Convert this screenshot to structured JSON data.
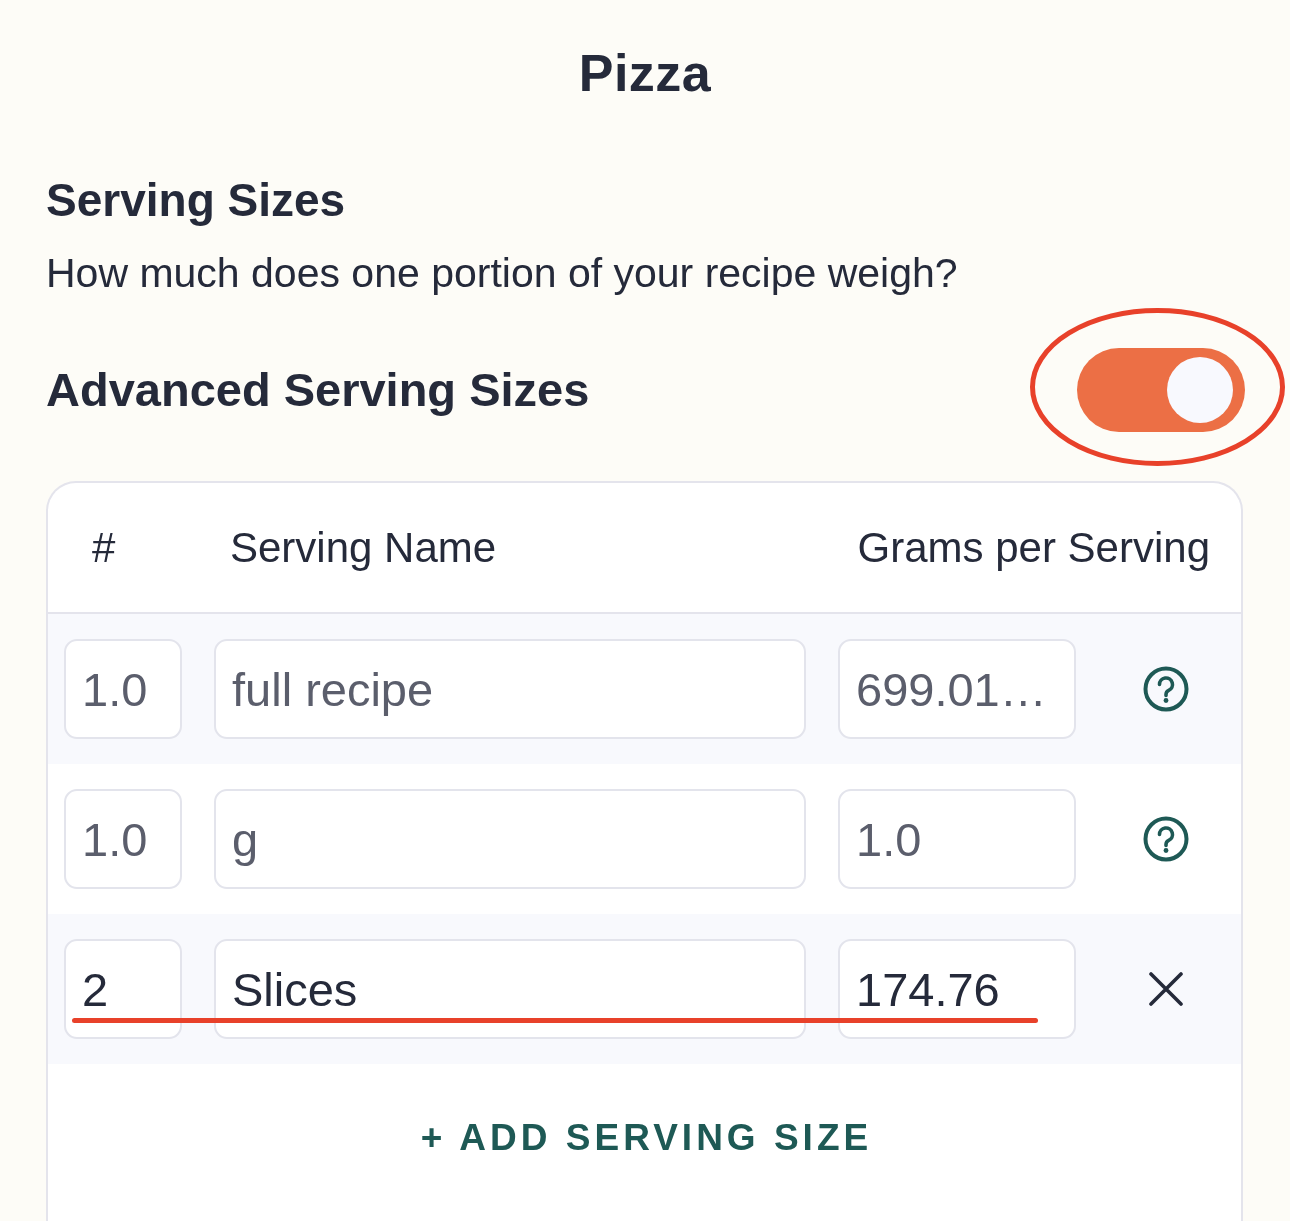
{
  "title": "Pizza",
  "serving_sizes": {
    "heading": "Serving Sizes",
    "description": "How much does one portion of your recipe weigh?"
  },
  "advanced": {
    "label": "Advanced Serving Sizes",
    "on": true,
    "circled": true
  },
  "table": {
    "columns": [
      "#",
      "Serving Name",
      "Grams per Serving"
    ],
    "rows": [
      {
        "kind": "fixed",
        "count": "1.0",
        "name": "full recipe",
        "grams": "699.01…",
        "disabled": true,
        "underlined": false
      },
      {
        "kind": "fixed",
        "count": "1.0",
        "name": "g",
        "grams": "1.0",
        "disabled": true,
        "underlined": false
      },
      {
        "kind": "custom",
        "count": "2",
        "name": "Slices",
        "grams": "174.76",
        "disabled": false,
        "underlined": true
      }
    ]
  },
  "add_button": {
    "label": "+ ADD SERVING SIZE"
  }
}
